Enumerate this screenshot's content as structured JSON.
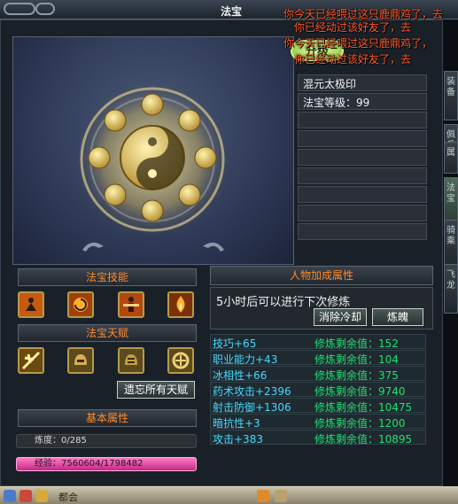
{
  "window": {
    "title": "法宝"
  },
  "chat": {
    "lines": [
      "你今天已经喂过这只鹿鼎鸡了，去",
      "你已经动过该好友了，去",
      "你今天已经喂过这只鹿鼎鸡了，",
      "你已经动过该好友了，去"
    ]
  },
  "upgrade_button": "升级",
  "artifact": {
    "name": "混元太极印",
    "level_label": "法宝等级：",
    "level": "99"
  },
  "skills_section": {
    "title": "法宝技能"
  },
  "talent_section": {
    "title": "法宝天赋",
    "forget_all_label": "遗忘所有天赋"
  },
  "basic_section": {
    "title": "基本属性",
    "refine_label": "炼度：",
    "refine_value": "0/285",
    "exp_label": "经验：",
    "exp_value": "7560604/1798482"
  },
  "bonus_section": {
    "title": "人物加成属性",
    "status_text": "5小时后可以进行下次修炼",
    "clear_cd_label": "消除冷却",
    "refine_soul_label": "炼魄"
  },
  "attributes": [
    {
      "name": "技巧+65",
      "remain": "修炼剩余值：152"
    },
    {
      "name": "职业能力+43",
      "remain": "修炼剩余值：104"
    },
    {
      "name": "冰相性+66",
      "remain": "修炼剩余值：375"
    },
    {
      "name": "药术攻击+2396",
      "remain": "修炼剩余值：9740"
    },
    {
      "name": "射击防御+1306",
      "remain": "修炼剩余值：10475"
    },
    {
      "name": "暗抗性+3",
      "remain": "修炼剩余值：1200"
    },
    {
      "name": "攻击+383",
      "remain": "修炼剩余值：10895"
    }
  ],
  "side_tabs": [
    "装备",
    "佩兵",
    "属",
    "法宝",
    "骑乘",
    "飞龙"
  ],
  "taskbar": {
    "items": [
      "都会"
    ]
  },
  "colors": {
    "accent_orange": "#ff8a2a",
    "attr_name": "#48d8ff",
    "attr_value": "#20e070",
    "chat_red": "#ff5a2a"
  }
}
